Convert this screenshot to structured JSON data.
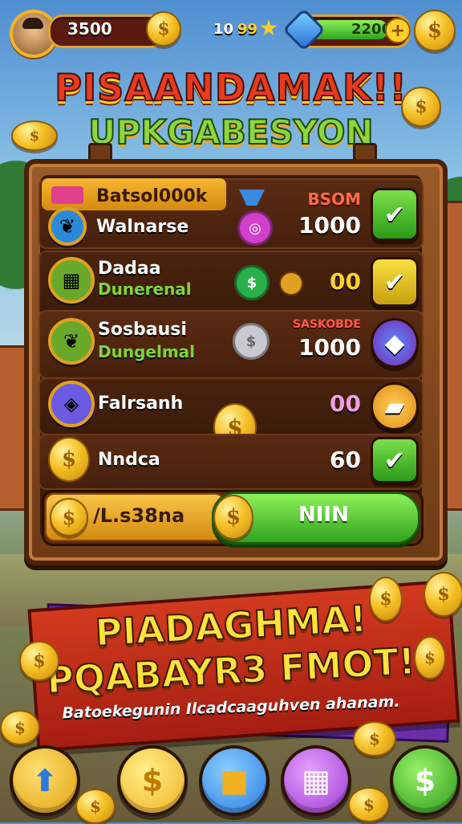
{
  "topbar": {
    "coins": "3500",
    "stars": "10",
    "currency_label": "99",
    "energy": "2200"
  },
  "title": {
    "line1": "PISAANDAMAK!!",
    "line2": "UPKGABESYON"
  },
  "board": {
    "header": "Batsol000k",
    "header_tag": "BSOM",
    "rows": [
      {
        "title": "Walnarse",
        "sub": "",
        "value": "1000",
        "tag": ""
      },
      {
        "title": "Dadaa",
        "sub": "Dunerenal",
        "value": "00",
        "tag": ""
      },
      {
        "title": "Sosbausi",
        "sub": "Dungelmal",
        "value": "1000",
        "tag": "SASKOBDE"
      },
      {
        "title": "Falrsanh",
        "sub": "",
        "value": "00",
        "tag": ""
      },
      {
        "title": "Nndca",
        "sub": "",
        "value": "60",
        "tag": ""
      }
    ],
    "collect_amount": "/L.s38na",
    "collect_button": "NIIN"
  },
  "banner": {
    "line1": "PIADAGHMA!",
    "line2": "PQABAYR3 FMOT!",
    "subtitle": "Batoekegunin Ilcadcaaguhven ahanam."
  },
  "icons": {
    "coin": "dollar-coin-icon",
    "check": "checkmark-icon",
    "shield": "shield-gem-icon"
  },
  "colors": {
    "accent_gold": "#f6c026",
    "accent_green": "#2fa41e",
    "banner_red": "#d23a1e",
    "title_red": "#e83a1e"
  }
}
